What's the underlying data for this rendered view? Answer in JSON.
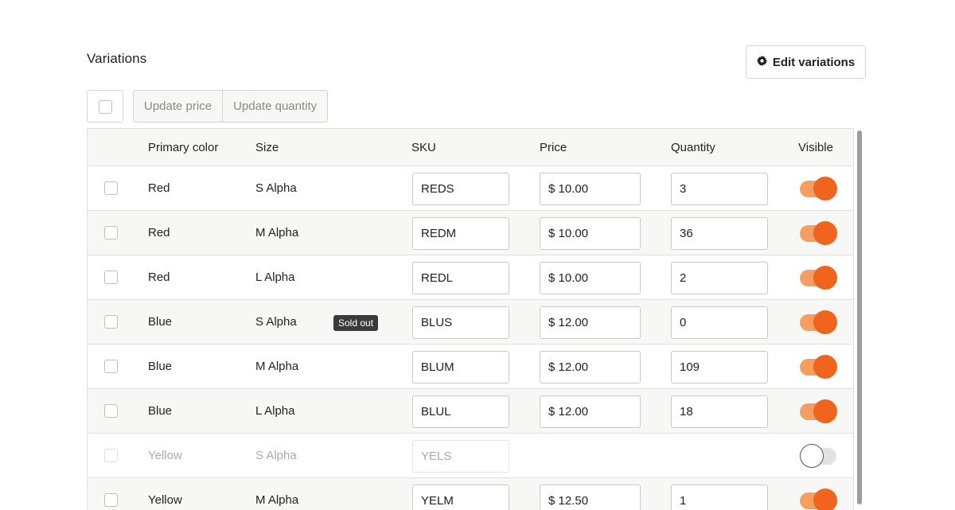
{
  "section": {
    "title": "Variations",
    "edit_button": "Edit variations"
  },
  "bulk_actions": {
    "update_price": "Update price",
    "update_quantity": "Update quantity"
  },
  "table": {
    "headers": {
      "primary_color": "Primary color",
      "size": "Size",
      "sku": "SKU",
      "price": "Price",
      "quantity": "Quantity",
      "visible": "Visible"
    },
    "rows": [
      {
        "color": "Red",
        "size": "S Alpha",
        "sku": "REDS",
        "price": "$ 10.00",
        "quantity": "3",
        "visible": true,
        "badge": ""
      },
      {
        "color": "Red",
        "size": "M Alpha",
        "sku": "REDM",
        "price": "$ 10.00",
        "quantity": "36",
        "visible": true,
        "badge": ""
      },
      {
        "color": "Red",
        "size": "L Alpha",
        "sku": "REDL",
        "price": "$ 10.00",
        "quantity": "2",
        "visible": true,
        "badge": ""
      },
      {
        "color": "Blue",
        "size": "S Alpha",
        "sku": "BLUS",
        "price": "$ 12.00",
        "quantity": "0",
        "visible": true,
        "badge": "Sold out"
      },
      {
        "color": "Blue",
        "size": "M Alpha",
        "sku": "BLUM",
        "price": "$ 12.00",
        "quantity": "109",
        "visible": true,
        "badge": ""
      },
      {
        "color": "Blue",
        "size": "L Alpha",
        "sku": "BLUL",
        "price": "$ 12.00",
        "quantity": "18",
        "visible": true,
        "badge": ""
      },
      {
        "color": "Yellow",
        "size": "S Alpha",
        "sku": "YELS",
        "price": "",
        "quantity": "",
        "visible": false,
        "badge": ""
      },
      {
        "color": "Yellow",
        "size": "M Alpha",
        "sku": "YELM",
        "price": "$ 12.50",
        "quantity": "1",
        "visible": true,
        "badge": ""
      }
    ]
  },
  "colors": {
    "accent": "#f1641e",
    "accent_track": "#f79d5f",
    "badge_bg": "#3b3b3b",
    "row_alt_bg": "#f7f7f5"
  },
  "icons": {
    "edit_variations": "gear-icon"
  }
}
